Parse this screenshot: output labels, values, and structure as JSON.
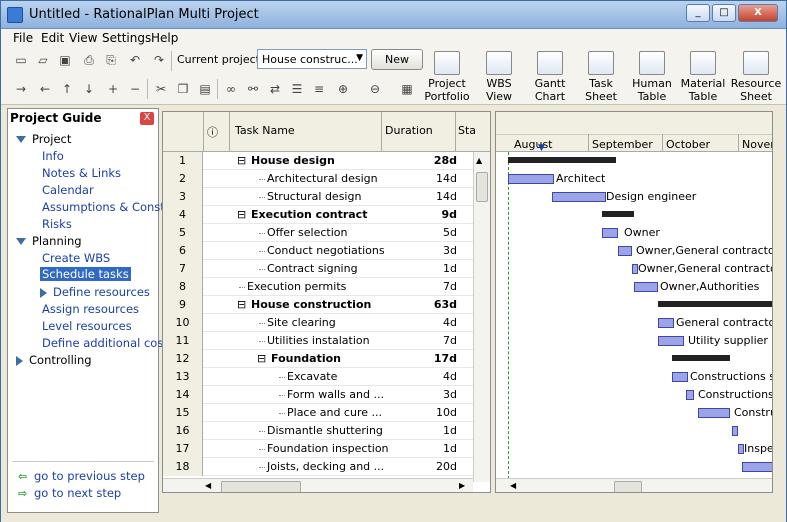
{
  "window": {
    "title": "Untitled - RationalPlan Multi Project",
    "minimize": "_",
    "maximize": "□",
    "close": "X"
  },
  "menu": [
    "File",
    "Edit",
    "View",
    "Settings",
    "Help"
  ],
  "toolbar": {
    "current_project_label": "Current project:",
    "current_project_value": "House construc...",
    "new_label": "New",
    "portfolio": [
      "Project",
      "Portfolio"
    ],
    "views": [
      {
        "l1": "WBS",
        "l2": "View"
      },
      {
        "l1": "Gantt",
        "l2": "Chart"
      },
      {
        "l1": "Task",
        "l2": "Sheet"
      },
      {
        "l1": "Human",
        "l2": "Table"
      },
      {
        "l1": "Material",
        "l2": "Table"
      },
      {
        "l1": "Resource",
        "l2": "Sheet"
      }
    ]
  },
  "guide": {
    "title": "Project Guide",
    "close": "X",
    "sections": {
      "project": "Project",
      "info": "Info",
      "notes": "Notes & Links",
      "calendar": "Calendar",
      "assumptions": "Assumptions & Constra",
      "risks": "Risks",
      "planning": "Planning",
      "create_wbs": "Create WBS",
      "schedule_tasks": "Schedule tasks",
      "define_resources": "Define resources",
      "assign_resources": "Assign resources",
      "level_resources": "Level resources",
      "define_costs": "Define additional costs",
      "controlling": "Controlling"
    },
    "prev": "go to previous step",
    "next": "go to next step"
  },
  "grid": {
    "col_info": "ⓘ",
    "col_task": "Task Name",
    "col_duration": "Duration",
    "col_start": "Sta",
    "rows": [
      {
        "n": "1",
        "name": "House design",
        "dur": "28d"
      },
      {
        "n": "2",
        "name": "Architectural design",
        "dur": "14d"
      },
      {
        "n": "3",
        "name": "Structural design",
        "dur": "14d"
      },
      {
        "n": "4",
        "name": "Execution contract",
        "dur": "9d"
      },
      {
        "n": "5",
        "name": "Offer selection",
        "dur": "5d"
      },
      {
        "n": "6",
        "name": "Conduct negotiations",
        "dur": "3d"
      },
      {
        "n": "7",
        "name": "Contract signing",
        "dur": "1d"
      },
      {
        "n": "8",
        "name": "Execution permits",
        "dur": "7d"
      },
      {
        "n": "9",
        "name": "House construction",
        "dur": "63d"
      },
      {
        "n": "10",
        "name": "Site clearing",
        "dur": "4d"
      },
      {
        "n": "11",
        "name": "Utilities instalation",
        "dur": "7d"
      },
      {
        "n": "12",
        "name": "Foundation",
        "dur": "17d"
      },
      {
        "n": "13",
        "name": "Excavate",
        "dur": "4d"
      },
      {
        "n": "14",
        "name": "Form walls and ...",
        "dur": "3d"
      },
      {
        "n": "15",
        "name": "Place and cure ...",
        "dur": "10d"
      },
      {
        "n": "16",
        "name": "Dismantle shuttering",
        "dur": "1d"
      },
      {
        "n": "17",
        "name": "Foundation inspection",
        "dur": "1d"
      },
      {
        "n": "18",
        "name": "Joists, decking and ...",
        "dur": "20d"
      }
    ]
  },
  "gantt": {
    "months": [
      "August",
      "September",
      "October",
      "Nover"
    ],
    "resources": [
      "Architect",
      "Design engineer",
      "Owner",
      "Owner,General contractor",
      "Owner,General contractor",
      "Owner,Authorities",
      "General contractor,G",
      "Utility supplier",
      "Constructions sub",
      "Constructions s",
      "Constru",
      "Inspec"
    ]
  }
}
